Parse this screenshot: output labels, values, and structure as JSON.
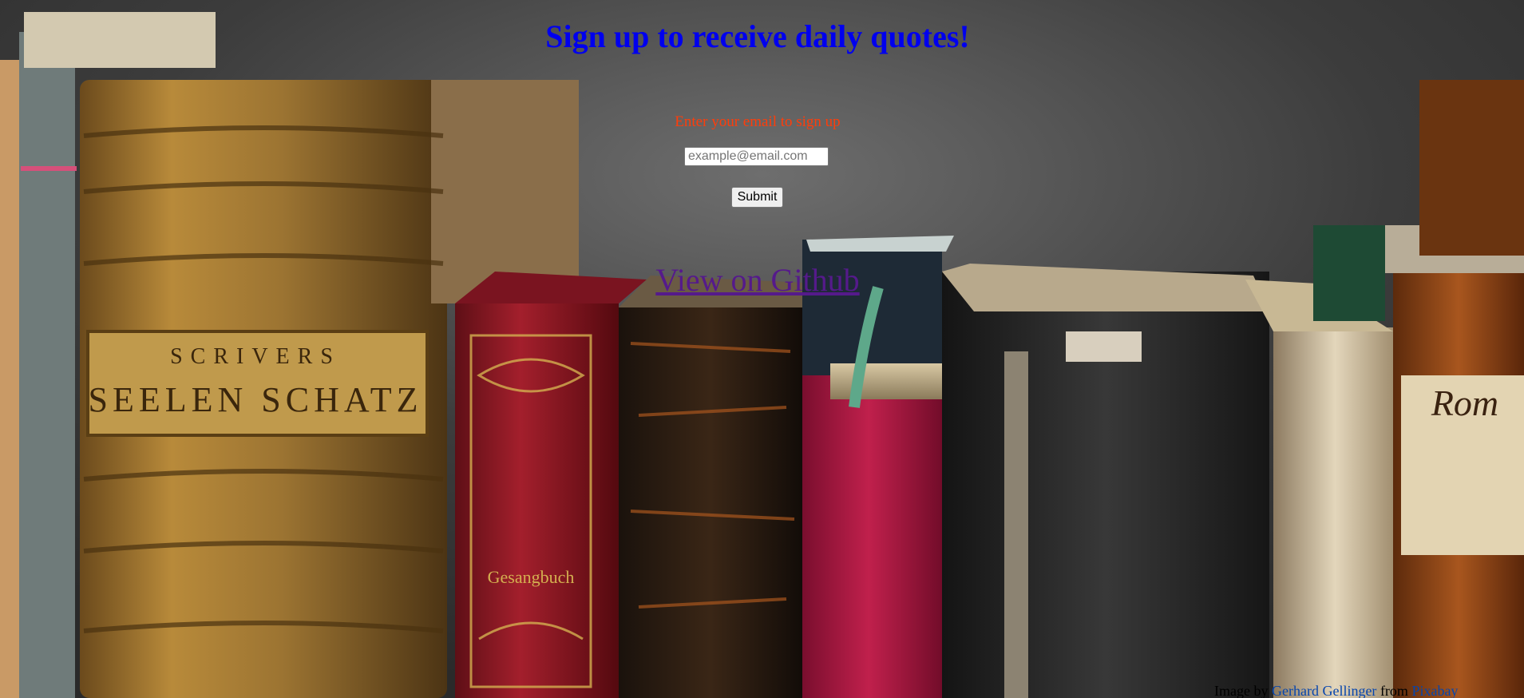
{
  "header": {
    "title": "Sign up to receive daily quotes!"
  },
  "signup": {
    "prompt": "Enter your email to sign up",
    "email_placeholder": "example@email.com",
    "submit_label": "Submit"
  },
  "github_link": {
    "label": "View on Github"
  },
  "credit": {
    "prefix": "Image by ",
    "author": "Gerhard Gellinger",
    "middle": " from ",
    "source": "Pixabay"
  },
  "background": {
    "description_icon": "old-books-photo",
    "book_spine_text": [
      "SCRIVERS",
      "SEELEN SCHATZ",
      "Gesangbuch",
      "Rom"
    ]
  },
  "colors": {
    "title": "#0000ee",
    "prompt": "#ff3d0a",
    "link": "#551a8b"
  }
}
